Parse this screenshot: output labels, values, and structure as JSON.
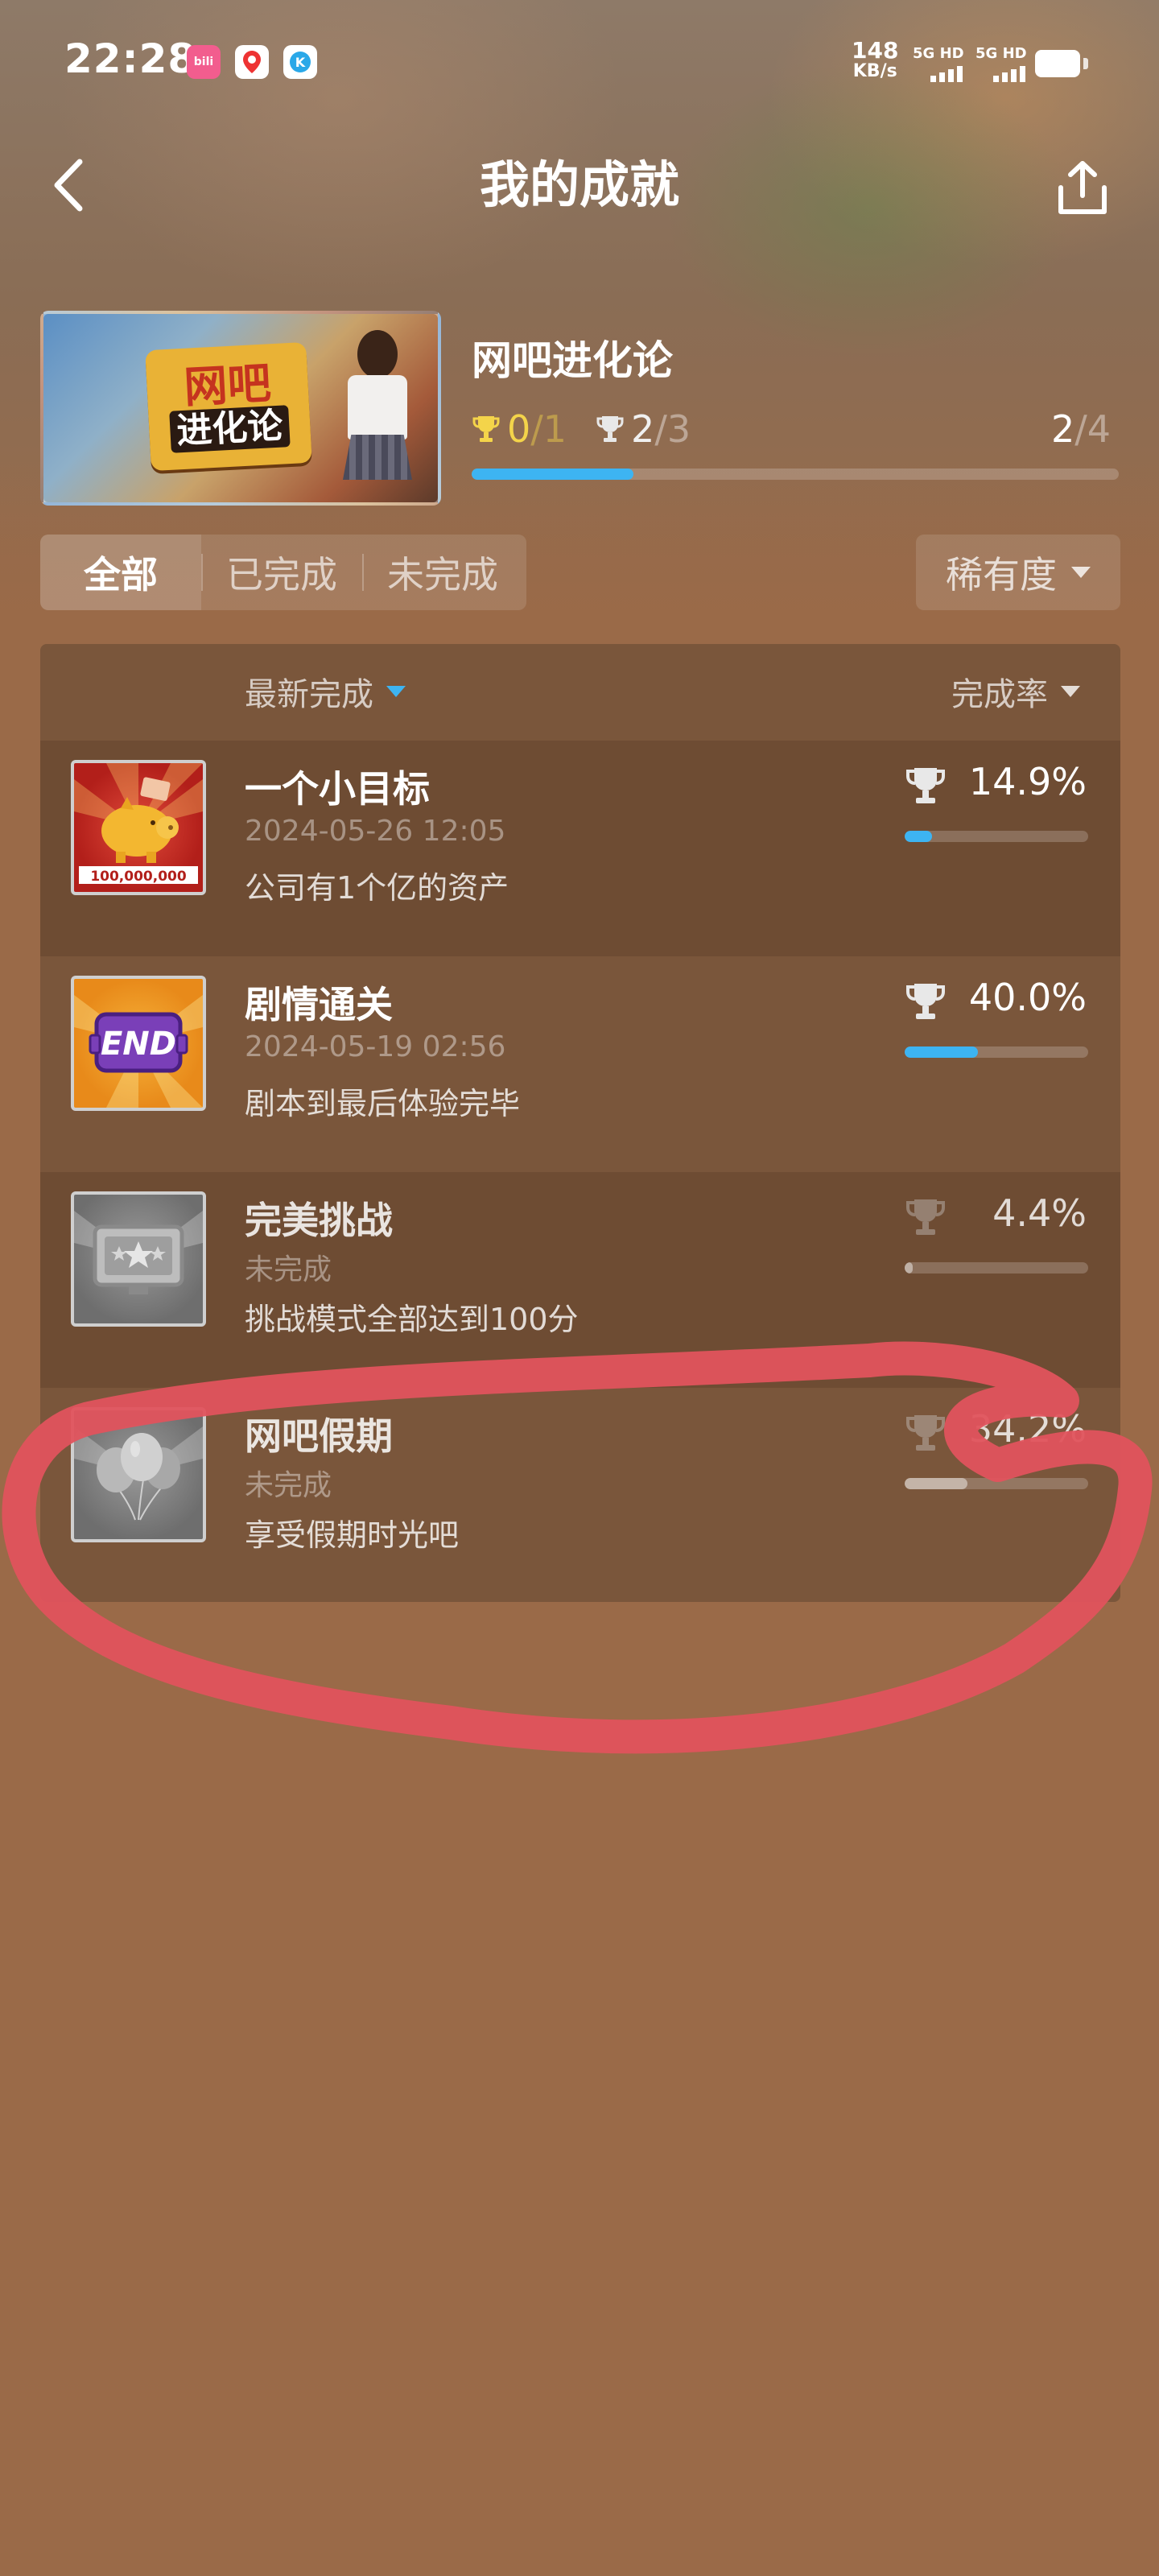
{
  "status_bar": {
    "time": "22:28",
    "net_speed_value": "148",
    "net_speed_unit": "KB/s",
    "sim1_label": "5G HD",
    "sim2_label": "5G HD",
    "app_icons": [
      "bilibili-icon",
      "maps-icon",
      "k-app-icon"
    ]
  },
  "header": {
    "title": "我的成就",
    "back_icon": "chevron-left-icon",
    "share_icon": "share-icon"
  },
  "game": {
    "name": "网吧进化论",
    "thumb_logo_line1": "网吧",
    "thumb_logo_line2": "进化论",
    "gold_earned": "0",
    "gold_total": "/1",
    "silver_earned": "2",
    "silver_total": "/3",
    "completed": "2",
    "completed_total": "/4",
    "progress_fraction": 0.25
  },
  "filters": {
    "tabs": [
      {
        "label": "全部",
        "active": true
      },
      {
        "label": "已完成",
        "active": false
      },
      {
        "label": "未完成",
        "active": false
      }
    ],
    "rarity_label": "稀有度"
  },
  "list": {
    "sort_latest_label": "最新完成",
    "sort_rate_label": "完成率",
    "items": [
      {
        "title": "一个小目标",
        "date": "2024-05-26 12:05",
        "description": "公司有1个亿的资产",
        "rate": "14.9%",
        "rate_fraction": 0.149,
        "completed": true,
        "icon_caption": "100,000,000",
        "icon": "piggy-bank-icon"
      },
      {
        "title": "剧情通关",
        "date": "2024-05-19 02:56",
        "description": "剧本到最后体验完毕",
        "rate": "40.0%",
        "rate_fraction": 0.4,
        "completed": true,
        "icon_caption": "END",
        "icon": "end-badge-icon"
      },
      {
        "title": "完美挑战",
        "date": "未完成",
        "description": "挑战模式全部达到100分",
        "rate": "4.4%",
        "rate_fraction": 0.044,
        "completed": false,
        "icon": "monitor-stars-icon"
      },
      {
        "title": "网吧假期",
        "date": "未完成",
        "description": "享受假期时光吧",
        "rate": "34.2%",
        "rate_fraction": 0.342,
        "completed": false,
        "icon": "balloons-icon"
      }
    ]
  },
  "colors": {
    "accent": "#3db4f2",
    "gold": "#f4d44a",
    "background": "#9a6a48",
    "panel": "#7a563b",
    "annotation": "#e0535d"
  }
}
